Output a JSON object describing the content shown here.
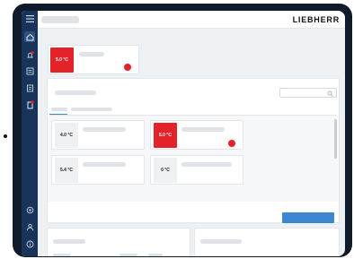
{
  "header": {
    "brand": "LIEBHERR"
  },
  "featured_appliance": {
    "temperature": "5.0 °C",
    "alert": true
  },
  "appliances": [
    {
      "temperature": "4.0 °C",
      "alert": false
    },
    {
      "temperature": "5.0 °C",
      "alert": true
    },
    {
      "temperature": "5.4 °C",
      "alert": false
    },
    {
      "temperature": "0 °C",
      "alert": false
    }
  ],
  "colors": {
    "sidebar": "#19345a",
    "alert": "#e3222a",
    "primary_button": "#3f86d1",
    "frame": "#0f1a2b"
  },
  "icons": [
    "menu-icon",
    "home-icon",
    "bell-icon",
    "list-icon",
    "document-icon",
    "device-icon",
    "settings-icon",
    "user-icon",
    "help-icon",
    "search-icon"
  ]
}
